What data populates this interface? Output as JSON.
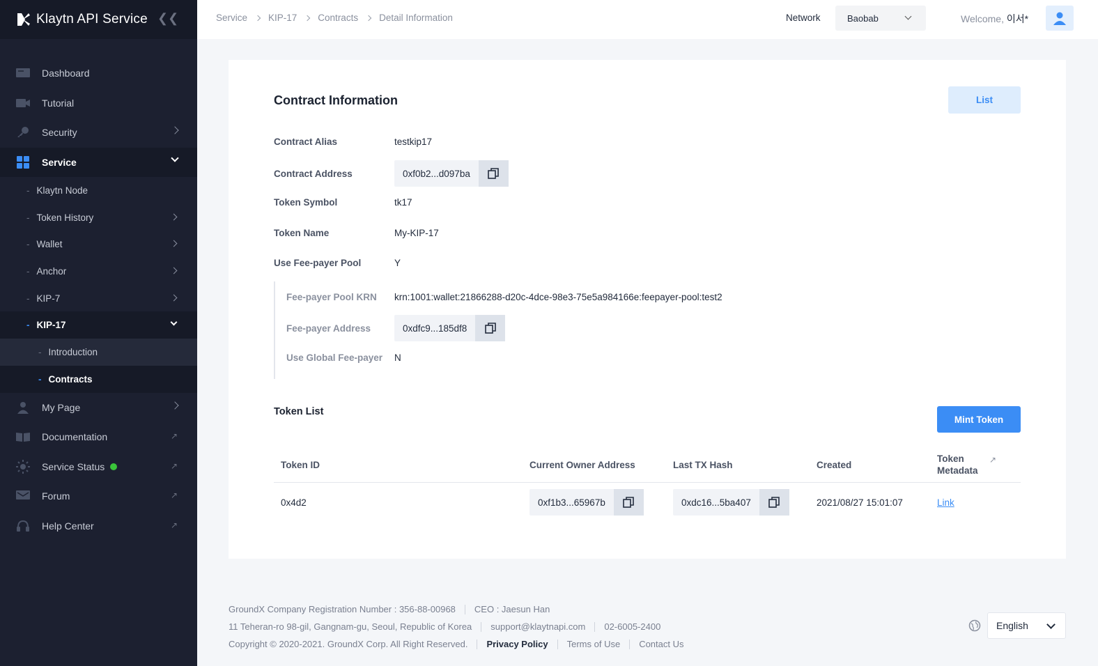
{
  "brand": {
    "title": "Klaytn API Service"
  },
  "sidebar": {
    "items": [
      {
        "label": "Dashboard",
        "icon": "dashboard-icon"
      },
      {
        "label": "Tutorial",
        "icon": "video-icon"
      },
      {
        "label": "Security",
        "icon": "key-icon"
      },
      {
        "label": "Service",
        "icon": "grid-icon"
      }
    ],
    "service_sub": [
      {
        "label": "Klaytn Node"
      },
      {
        "label": "Token History"
      },
      {
        "label": "Wallet"
      },
      {
        "label": "Anchor"
      },
      {
        "label": "KIP-7"
      },
      {
        "label": "KIP-17"
      }
    ],
    "kip17_sub": [
      {
        "label": "Introduction"
      },
      {
        "label": "Contracts"
      }
    ],
    "bottom_items": [
      {
        "label": "My Page",
        "icon": "user-icon"
      },
      {
        "label": "Documentation",
        "icon": "book-icon"
      },
      {
        "label": "Service Status",
        "icon": "sun-icon"
      },
      {
        "label": "Forum",
        "icon": "message-icon"
      },
      {
        "label": "Help Center",
        "icon": "headset-icon"
      }
    ],
    "status_color": "#3ac43a"
  },
  "header": {
    "breadcrumb": [
      "Service",
      "KIP-17",
      "Contracts",
      "Detail Information"
    ],
    "network_label": "Network",
    "network_value": "Baobab",
    "welcome_prefix": "Welcome,",
    "welcome_name": "이서*"
  },
  "contract": {
    "title": "Contract Information",
    "list_button": "List",
    "fields": {
      "alias_label": "Contract Alias",
      "alias_value": "testkip17",
      "address_label": "Contract Address",
      "address_value": "0xf0b2...d097ba",
      "symbol_label": "Token Symbol",
      "symbol_value": "tk17",
      "name_label": "Token Name",
      "name_value": "My-KIP-17",
      "pool_label": "Use Fee-payer Pool",
      "pool_value": "Y",
      "krn_label": "Fee-payer Pool KRN",
      "krn_value": "krn:1001:wallet:21866288-d20c-4dce-98e3-75e5a984166e:feepayer-pool:test2",
      "fee_addr_label": "Fee-payer Address",
      "fee_addr_value": "0xdfc9...185df8",
      "global_label": "Use Global Fee-payer",
      "global_value": "N"
    }
  },
  "token_list": {
    "title": "Token List",
    "mint_button": "Mint Token",
    "columns": [
      "Token ID",
      "Current Owner Address",
      "Last TX Hash",
      "Created",
      "Token",
      "Metadata"
    ],
    "rows": [
      {
        "id": "0x4d2",
        "owner": "0xf1b3...65967b",
        "tx": "0xdc16...5ba407",
        "created": "2021/08/27 15:01:07",
        "metadata": "Link"
      }
    ]
  },
  "footer": {
    "reg": "GroundX Company Registration Number : 356-88-00968",
    "ceo": "CEO : Jaesun Han",
    "address": "11 Teheran-ro 98-gil, Gangnam-gu, Seoul, Republic of Korea",
    "email": "support@klaytnapi.com",
    "phone": "02-6005-2400",
    "copyright": "Copyright © 2020-2021. GroundX Corp. All Right Reserved.",
    "privacy": "Privacy Policy",
    "terms": "Terms of Use",
    "contact": "Contact Us",
    "language": "English"
  },
  "colors": {
    "accent": "#3b8df5",
    "sidebar_bg": "#1c2030"
  }
}
